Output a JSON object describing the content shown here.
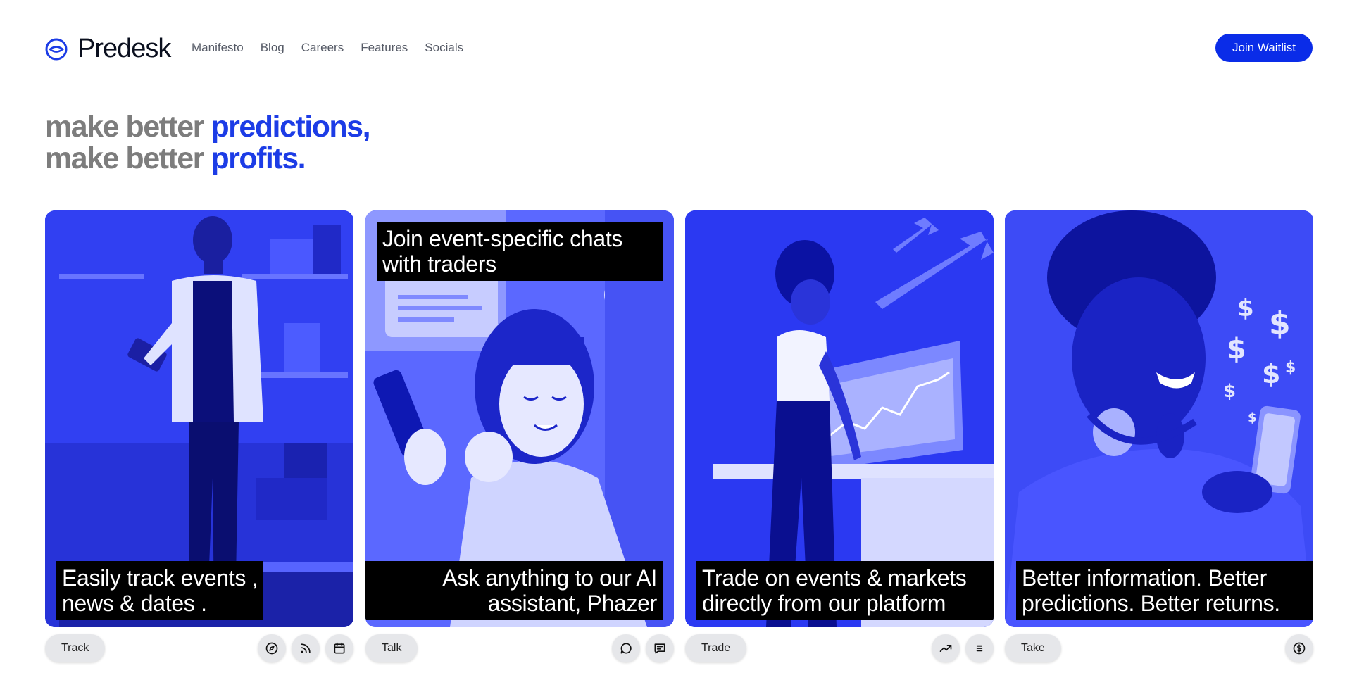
{
  "brand": {
    "name": "Predesk",
    "logo_icon": "eye-logo-icon"
  },
  "nav": [
    {
      "label": "Manifesto"
    },
    {
      "label": "Blog"
    },
    {
      "label": "Careers"
    },
    {
      "label": "Features"
    },
    {
      "label": "Socials"
    }
  ],
  "cta": {
    "label": "Join Waitlist"
  },
  "hero": {
    "line1_gray": "make better ",
    "line1_blue": "predictions,",
    "line2_gray": "make better ",
    "line2_blue": "profits."
  },
  "cards": [
    {
      "caption_bottom": "Easily track events ,\nnews & dates .",
      "tab": "Track",
      "icons": [
        "compass-icon",
        "rss-icon",
        "calendar-icon"
      ]
    },
    {
      "caption_top": "Join event-specific chats\nwith traders",
      "caption_bottom": "Ask anything to our AI\nassistant, Phazer",
      "tab": "Talk",
      "icons": [
        "chat-bubble-icon",
        "message-square-text-icon"
      ]
    },
    {
      "caption_bottom": "Trade on events & markets\ndirectly from our platform",
      "tab": "Trade",
      "icons": [
        "trending-up-icon",
        "list-icon"
      ]
    },
    {
      "caption_bottom": "Better information. Better\npredictions. Better returns.",
      "tab": "Take",
      "icons": [
        "dollar-circle-icon"
      ]
    }
  ],
  "colors": {
    "accent": "#0a2ce8",
    "hero_blue": "#1c3ce6",
    "hero_gray": "#7d7d7d",
    "card_blue": "#2e3ef5",
    "caption_bg": "#000000"
  }
}
